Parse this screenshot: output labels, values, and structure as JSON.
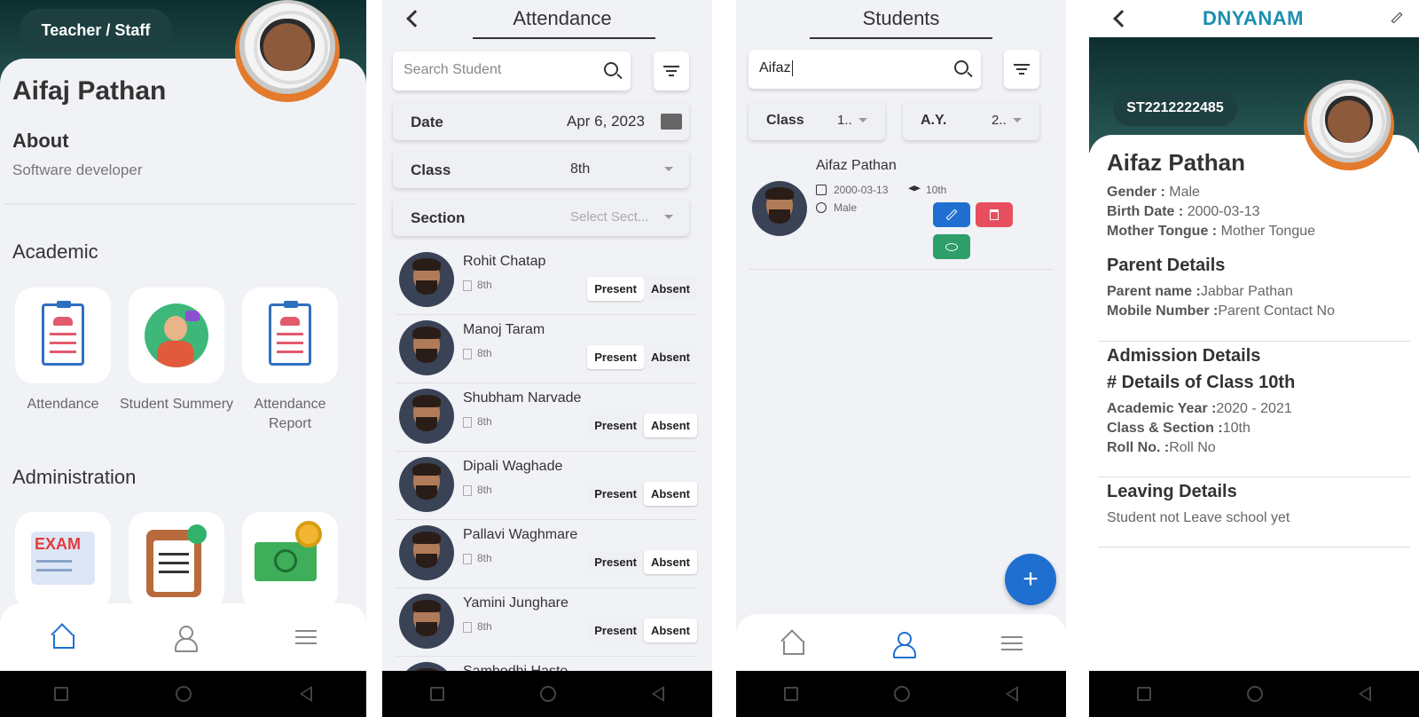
{
  "p1": {
    "role": "Teacher / Staff",
    "name": "Aifaj Pathan",
    "about_title": "About",
    "about_text": "Software developer",
    "academic": "Academic",
    "tiles": [
      {
        "label": "Attendance"
      },
      {
        "label": "Student Summery"
      },
      {
        "label": "Attendance Report"
      }
    ],
    "administration": "Administration",
    "admin_tiles": [
      {
        "icon": "exam-icon",
        "text": "EXAM"
      },
      {
        "icon": "clipboard-robot-icon"
      },
      {
        "icon": "money-gear-icon"
      }
    ],
    "nav": [
      "home-icon",
      "profile-icon",
      "menu-icon"
    ],
    "active_color": "#1f6fd1"
  },
  "p2": {
    "title": "Attendance",
    "search_placeholder": "Search Student",
    "date_label": "Date",
    "date_value": "Apr 6, 2023",
    "class_label": "Class",
    "class_value": "8th",
    "section_label": "Section",
    "section_placeholder": "Select Sect...",
    "present": "Present",
    "absent": "Absent",
    "students": [
      {
        "name": "Rohit Chatap",
        "class": "8th",
        "selected": "present"
      },
      {
        "name": "Manoj Taram",
        "class": "8th",
        "selected": "present"
      },
      {
        "name": "Shubham Narvade",
        "class": "8th",
        "selected": "absent"
      },
      {
        "name": "Dipali Waghade",
        "class": "8th",
        "selected": "absent"
      },
      {
        "name": "Pallavi Waghmare",
        "class": "8th",
        "selected": "absent"
      },
      {
        "name": "Yamini Junghare",
        "class": "8th",
        "selected": "absent"
      },
      {
        "name": "Sambodhi Haste"
      }
    ]
  },
  "p3": {
    "title": "Students",
    "search_value": "Aifaz",
    "class_label": "Class",
    "class_value": "1..",
    "ay_label": "A.Y.",
    "ay_value": "2..",
    "student": {
      "name": "Aifaz Pathan",
      "dob": "2000-03-13",
      "class": "10th",
      "gender": "Male"
    },
    "edit_color": "#1f6fd1",
    "delete_color": "#e74f5f",
    "view_color": "#2e9e6b",
    "fab": "+"
  },
  "p4": {
    "brand": "DNYANAM",
    "brand_color": "#1a8fb0",
    "id": "ST2212222485",
    "name": "Aifaz Pathan",
    "gender_label": "Gender :",
    "gender": "Male",
    "birth_label": "Birth Date :",
    "birth": "2000-03-13",
    "tongue_label": "Mother Tongue :",
    "tongue": "Mother Tongue",
    "parent_title": "Parent Details",
    "parent_name_label": "Parent name :",
    "parent_name": "Jabbar  Pathan",
    "mobile_label": "Mobile Number :",
    "mobile": "Parent Contact No",
    "admission_title": "Admission Details",
    "class_details": "# Details of Class 10th",
    "ay_label": "Academic Year :",
    "ay": "2020 - 2021",
    "cs_label": "Class & Section :",
    "cs": "10th",
    "roll_label": "Roll No. :",
    "roll": "Roll No",
    "leaving_title": "Leaving Details",
    "leaving_text": "Student not Leave school yet"
  }
}
